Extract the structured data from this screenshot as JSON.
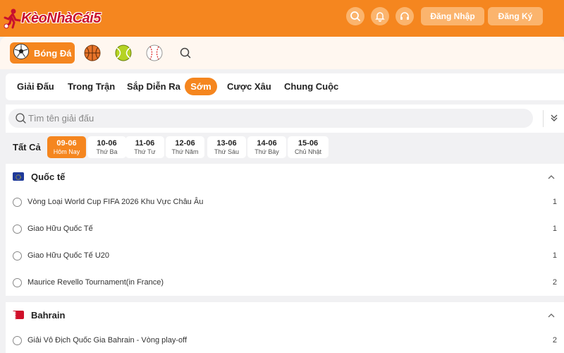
{
  "header": {
    "logo_text": "KèoNhàCái5",
    "icons": [
      "search-icon",
      "bell-icon",
      "headset-icon"
    ],
    "login_label": "Đăng Nhập",
    "register_label": "Đăng Ký",
    "accent_color": "#f5861f"
  },
  "sports": {
    "active_label": "Bóng Đá",
    "items": [
      "soccer-ball-icon",
      "basketball-icon",
      "tennis-ball-icon",
      "baseball-icon",
      "search-icon"
    ]
  },
  "tabs": {
    "items": [
      "Giải Đấu",
      "Trong Trận",
      "Sắp Diễn Ra",
      "Sớm",
      "Cược Xâu",
      "Chung Cuộc"
    ],
    "active": "Sớm"
  },
  "search": {
    "placeholder": "Tìm tên giải đấu"
  },
  "dates": {
    "all_label": "Tất Cả",
    "items": [
      {
        "date": "09-06",
        "weekday": "Hôm Nay",
        "active": true
      },
      {
        "date": "10-06",
        "weekday": "Thứ Ba"
      },
      {
        "date": "11-06",
        "weekday": "Thứ Tư"
      },
      {
        "date": "12-06",
        "weekday": "Thứ Năm"
      },
      {
        "date": "13-06",
        "weekday": "Thứ Sáu"
      },
      {
        "date": "14-06",
        "weekday": "Thứ Bảy"
      },
      {
        "date": "15-06",
        "weekday": "Chủ Nhật"
      }
    ]
  },
  "sections": [
    {
      "title": "Quốc tế",
      "flag_icon": "eu-flag-icon",
      "leagues": [
        {
          "name": "Vòng Loại World Cup FIFA 2026 Khu Vực Châu Âu",
          "count": "1"
        },
        {
          "name": "Giao Hữu Quốc Tế",
          "count": "1"
        },
        {
          "name": "Giao Hữu Quốc Tế U20",
          "count": "1"
        },
        {
          "name": "Maurice Revello Tournament(in France)",
          "count": "2"
        }
      ]
    },
    {
      "title": "Bahrain",
      "flag_icon": "bahrain-flag-icon",
      "leagues": [
        {
          "name": "Giải Vô Địch Quốc Gia Bahrain - Vòng play-off",
          "count": "2"
        }
      ]
    }
  ]
}
